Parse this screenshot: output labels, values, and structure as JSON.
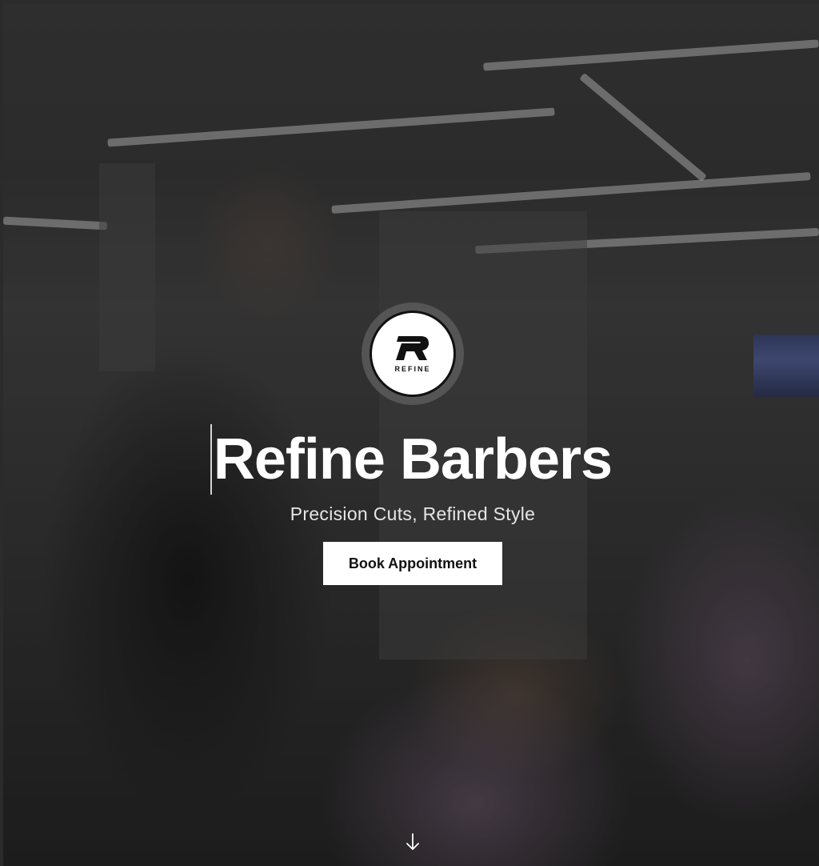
{
  "hero": {
    "background_description_icon": "barbershop-photo",
    "logo": {
      "icon": "refine-logo-icon",
      "wordmark": "REFINE"
    },
    "title": "Refine Barbers",
    "tagline": "Precision Cuts, Refined Style",
    "cta_label": "Book Appointment",
    "scroll_icon": "arrow-down-icon"
  },
  "colors": {
    "overlay": "#000000",
    "cta_background": "#ffffff",
    "cta_text": "#111111",
    "title_text": "#ffffff",
    "tagline_text": "#e6e6e6"
  }
}
